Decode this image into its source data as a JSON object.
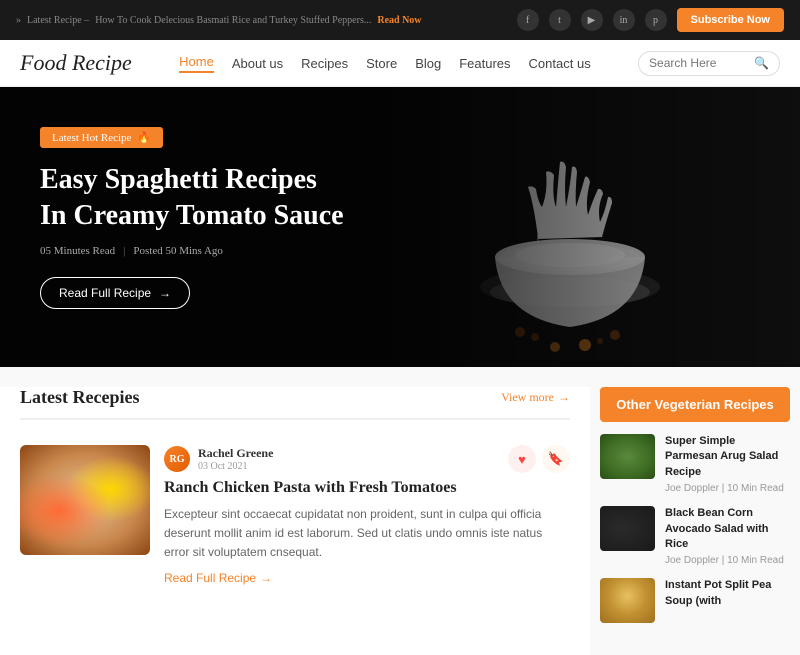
{
  "topbar": {
    "ticker_prefix": "Latest Recipe –",
    "ticker_text": "How To Cook Delecious Basmati Rice and Turkey Stuffed Peppers...",
    "read_now": "Read Now",
    "subscribe_label": "Subscribe Now"
  },
  "social": {
    "icons": [
      "f",
      "t",
      "y",
      "in",
      "p"
    ]
  },
  "header": {
    "logo": "Food Recipe",
    "nav": [
      {
        "label": "Home",
        "active": true
      },
      {
        "label": "About us"
      },
      {
        "label": "Recipes"
      },
      {
        "label": "Store"
      },
      {
        "label": "Blog"
      },
      {
        "label": "Features"
      },
      {
        "label": "Contact us"
      }
    ],
    "search_placeholder": "Search Here"
  },
  "hero": {
    "badge": "Latest Hot Recipe",
    "title_line1": "Easy Spaghetti Recipes",
    "title_line2": "In Creamy Tomato Sauce",
    "meta_read": "05 Minutes Read",
    "meta_divider": "|",
    "meta_posted": "Posted 50 Mins Ago",
    "cta_label": "Read Full Recipe",
    "cta_arrow": "→"
  },
  "latest": {
    "section_title": "Latest Recepies",
    "view_more": "View more",
    "card": {
      "author_name": "Rachel Greene",
      "author_date": "03 Oct 2021",
      "title": "Ranch Chicken Pasta with Fresh Tomatoes",
      "description": "Excepteur sint occaecat cupidatat non proident, sunt in culpa qui officia deserunt mollit anim id est laborum. Sed ut clatis undo omnis iste natus error sit voluptatem cnsequat.",
      "read_more": "Read Full Recipe",
      "read_more_arrow": "→"
    }
  },
  "sidebar": {
    "header": "Other Vegeterian Recipes",
    "items": [
      {
        "title": "Super Simple Parmesan Arug Salad Recipe",
        "author": "Joe Doppler",
        "read_time": "10 Min Read",
        "thumb_class": "sidebar-thumb-1"
      },
      {
        "title": "Black Bean Corn Avocado Salad with Rice",
        "author": "Joe Doppler",
        "read_time": "10 Min Read",
        "thumb_class": "sidebar-thumb-2"
      },
      {
        "title": "Instant Pot Split Pea Soup (with",
        "author": "",
        "read_time": "",
        "thumb_class": "sidebar-thumb-3"
      }
    ]
  }
}
